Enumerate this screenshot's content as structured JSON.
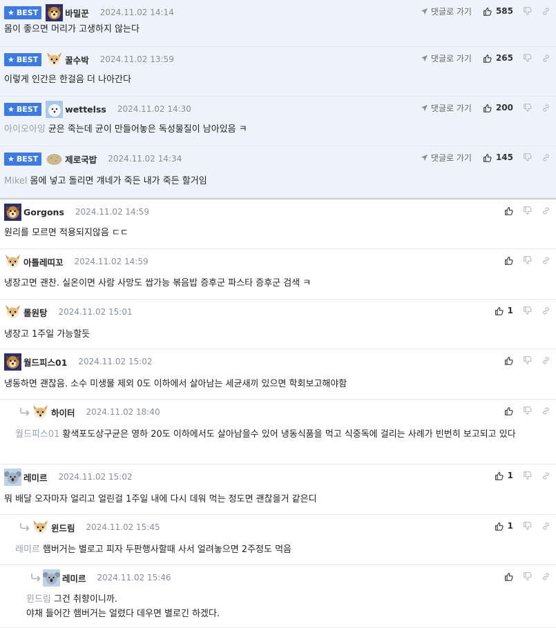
{
  "labels": {
    "best": "BEST",
    "goto_reply": "댓글로 가기"
  },
  "colors": {
    "best_bg": "#eef3fb",
    "badge": "#3d7be0",
    "date": "#8a8f97",
    "mention": "#9aa0a8"
  },
  "best_comments": [
    {
      "nick": "바밀꾼",
      "date": "2024.11.02 14:14",
      "likes": "585",
      "mention": "",
      "text": "몸이 좋으면 머리가 고생하지 않는다",
      "avatar": "dog-avatar"
    },
    {
      "nick": "꿀수박",
      "date": "2024.11.02 13:59",
      "likes": "265",
      "mention": "",
      "text": "이렇게 인간은 한걸음 더 나아간다",
      "avatar": "fox-avatar"
    },
    {
      "nick": "wettelss",
      "date": "2024.11.02 14:30",
      "likes": "200",
      "mention": "아이오아잉",
      "text": "균은 죽는데 균이 만들어놓은 독성물질이 남아있음 ㅋ",
      "avatar": "white-dog-avatar"
    },
    {
      "nick": "제로국밥",
      "date": "2024.11.02 14:34",
      "likes": "145",
      "mention": "Mikel",
      "text": "몸에 넣고 돌리면 걔네가 죽든 내가 죽든 할거임",
      "avatar": "potato-avatar"
    }
  ],
  "comments": [
    {
      "nick": "Gorgons",
      "date": "2024.11.02 14:59",
      "likes": "",
      "mention": "",
      "text": "원리를 모르면 적용되지않음 ㄷㄷ",
      "avatar": "dog-avatar"
    },
    {
      "nick": "아틀레띠꼬",
      "date": "2024.11.02 14:59",
      "likes": "",
      "mention": "",
      "text": "냉장고면 괜찬. 실온이면 사람 사망도 쌉가능 볶음밥 증후군 파스타 증후군 검색 ㅋ",
      "avatar": "fox-avatar"
    },
    {
      "nick": "롤원탕",
      "date": "2024.11.02 15:01",
      "likes": "1",
      "mention": "",
      "text": "냉장고 1주일 가능할듯",
      "avatar": "fox-avatar"
    },
    {
      "nick": "월드피스01",
      "date": "2024.11.02 15:02",
      "likes": "",
      "mention": "",
      "text": "냉동하면 괜찮음. 소수 미생물 제외 0도 이하에서 살아남는 세균새끼 있으면 학회보고해야함",
      "avatar": "dog-avatar"
    },
    {
      "nick": "하이터",
      "date": "2024.11.02 18:40",
      "likes": "",
      "mention": "월드피스01",
      "text": "황색포도상구균은 영하 20도 이하에서도 살아남을수 있어 냉동식품을 먹고 식중독에 걸리는 사례가 빈번히 보고되고 있다",
      "avatar": "fox-avatar"
    },
    {
      "nick": "레미르",
      "date": "2024.11.02 15:02",
      "likes": "1",
      "mention": "",
      "text": "뭐 배달 오자마자 얼리고 얼린걸 1주일 내에 다시 데워 먹는 정도면 괜찮을거 같은디",
      "avatar": "koala-avatar"
    },
    {
      "nick": "윈드림",
      "date": "2024.11.02 15:45",
      "likes": "1",
      "mention": "레미르",
      "text": "햄버거는 별로고 피자 두판행사할때 사서 얼려놓으면 2주정도 먹음",
      "avatar": "fox-avatar"
    },
    {
      "nick": "레미르",
      "date": "2024.11.02 15:46",
      "likes": "",
      "mention": "윈드림",
      "text": "그건 취향이니까.",
      "text2": "야채 들어간 햄버거는 얼렸다 데우면 별로긴 하겠다.",
      "avatar": "koala-avatar"
    }
  ]
}
